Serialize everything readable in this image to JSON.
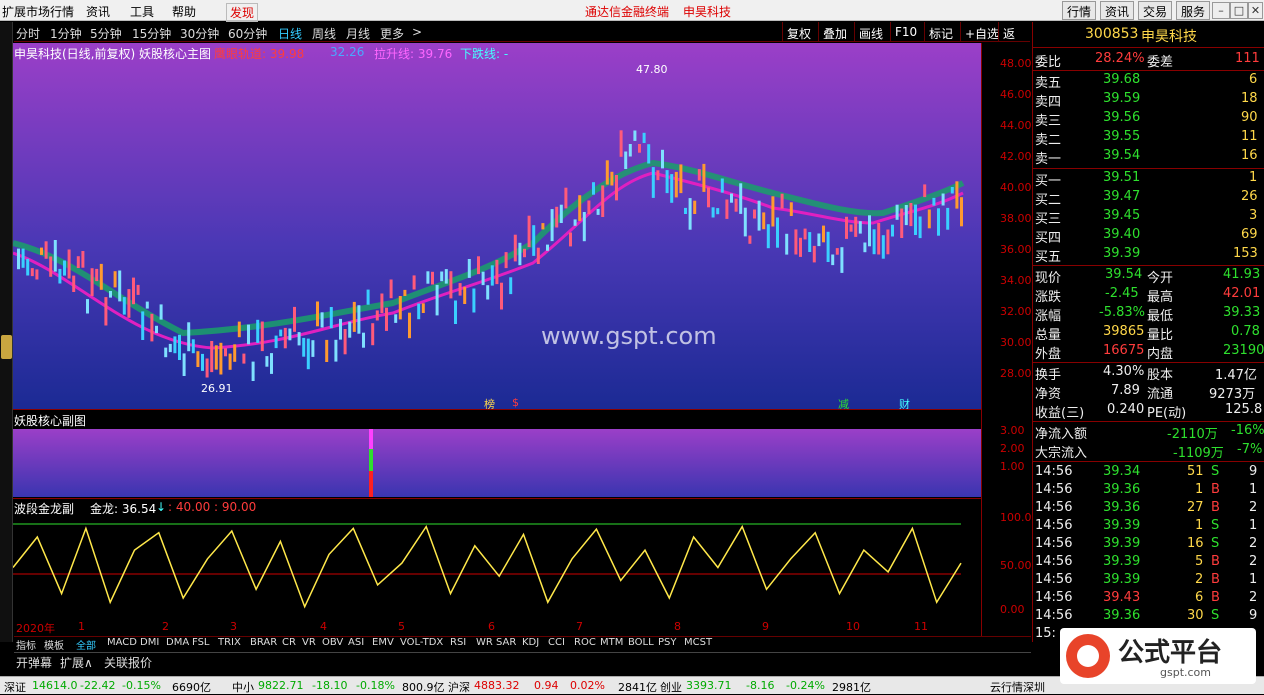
{
  "menubar": {
    "items": [
      "扩展市场行情",
      "资讯",
      "工具",
      "帮助",
      "发现"
    ],
    "center_left": "通达信金融终端",
    "center_right": "申昊科技",
    "right_buttons": [
      "行情",
      "资讯",
      "交易",
      "服务"
    ]
  },
  "periods": {
    "items": [
      "分时",
      "1分钟",
      "5分钟",
      "15分钟",
      "30分钟",
      "60分钟",
      "日线",
      "周线",
      "月线",
      "更多"
    ],
    "more_arrow": ">",
    "tools": [
      "复权",
      "叠加",
      "画线",
      "F10",
      "标记",
      "+自选",
      "返回"
    ]
  },
  "main_chart": {
    "title": "申昊科技(日线,前复权) 妖股核心主图",
    "line1_label": "鹰眼轨道: 39.98",
    "line2_label": "32.26",
    "line3_label": "拉升线: 39.76",
    "line4_label": "下跌线: -",
    "high_label": "47.80",
    "low_label": "26.91",
    "watermark": "www.gspt.com",
    "markers": [
      "榜",
      "$",
      "减",
      "财"
    ],
    "y_ticks": [
      "48.00",
      "46.00",
      "44.00",
      "42.00",
      "40.00",
      "38.00",
      "36.00",
      "34.00",
      "32.00",
      "30.00",
      "28.00"
    ]
  },
  "sub_chart1": {
    "title": "妖股核心副图",
    "y_ticks": [
      "3.00",
      "2.00",
      "1.00"
    ]
  },
  "sub_chart2": {
    "title": "波段金龙副",
    "value_label": "金龙: 36.54",
    "arrow": "↓",
    "levels_label": ": 40.00 : 90.00",
    "y_ticks": [
      "100.0",
      "50.00",
      "0.00"
    ]
  },
  "x_axis": {
    "labels": [
      "2020年",
      "1",
      "2",
      "3",
      "4",
      "5",
      "6",
      "7",
      "8",
      "9",
      "10",
      "11"
    ],
    "period_label": "日线"
  },
  "chart_data": {
    "type": "line",
    "series": [
      {
        "name": "金龙",
        "values": [
          50,
          85,
          20,
          95,
          10,
          70,
          90,
          15,
          60,
          92,
          25,
          80,
          5,
          65,
          95,
          30,
          55,
          97,
          20,
          75,
          40,
          88,
          10,
          60,
          94,
          35,
          70,
          15,
          85,
          50,
          97,
          25,
          60,
          90,
          20,
          70,
          45,
          95,
          10,
          55
        ]
      }
    ],
    "ylim": [
      0,
      100
    ]
  },
  "quote": {
    "code": "300853",
    "name": "申昊科技",
    "weibi_label": "委比",
    "weibi_val": "28.24%",
    "weicha_label": "委差",
    "weicha_val": "111",
    "asks": [
      {
        "label": "卖五",
        "price": "39.68",
        "vol": "6"
      },
      {
        "label": "卖四",
        "price": "39.59",
        "vol": "18"
      },
      {
        "label": "卖三",
        "price": "39.56",
        "vol": "90"
      },
      {
        "label": "卖二",
        "price": "39.55",
        "vol": "11"
      },
      {
        "label": "卖一",
        "price": "39.54",
        "vol": "16"
      }
    ],
    "bids": [
      {
        "label": "买一",
        "price": "39.51",
        "vol": "1"
      },
      {
        "label": "买二",
        "price": "39.47",
        "vol": "26"
      },
      {
        "label": "买三",
        "price": "39.45",
        "vol": "3"
      },
      {
        "label": "买四",
        "price": "39.40",
        "vol": "69"
      },
      {
        "label": "买五",
        "price": "39.39",
        "vol": "153"
      }
    ],
    "stats": [
      {
        "l1": "现价",
        "v1": "39.54",
        "l2": "今开",
        "v2": "41.93",
        "c1": "grn",
        "c2": "grn"
      },
      {
        "l1": "涨跌",
        "v1": "-2.45",
        "l2": "最高",
        "v2": "42.01",
        "c1": "grn",
        "c2": "red"
      },
      {
        "l1": "涨幅",
        "v1": "-5.83%",
        "l2": "最低",
        "v2": "39.33",
        "c1": "grn",
        "c2": "grn"
      },
      {
        "l1": "总量",
        "v1": "39865",
        "l2": "量比",
        "v2": "0.78",
        "c1": "yel",
        "c2": "grn"
      },
      {
        "l1": "外盘",
        "v1": "16675",
        "l2": "内盘",
        "v2": "23190",
        "c1": "red",
        "c2": "grn"
      },
      {
        "l1": "换手",
        "v1": "4.30%",
        "l2": "股本",
        "v2": "1.47亿",
        "c1": "wht",
        "c2": "wht"
      },
      {
        "l1": "净资",
        "v1": "7.89",
        "l2": "流通",
        "v2": "9273万",
        "c1": "wht",
        "c2": "wht"
      },
      {
        "l1": "收益(三)",
        "v1": "0.240",
        "l2": "PE(动)",
        "v2": "125.8",
        "c1": "wht",
        "c2": "wht"
      }
    ],
    "flow": [
      {
        "label": "净流入额",
        "val": "-2110万",
        "pct": "-16%"
      },
      {
        "label": "大宗流入",
        "val": "-1109万",
        "pct": "-7%"
      }
    ],
    "ticks": [
      {
        "t": "14:56",
        "p": "39.34",
        "v": "51",
        "s": "S",
        "n": "9"
      },
      {
        "t": "14:56",
        "p": "39.36",
        "v": "1",
        "s": "B",
        "n": "1"
      },
      {
        "t": "14:56",
        "p": "39.36",
        "v": "27",
        "s": "B",
        "n": "2"
      },
      {
        "t": "14:56",
        "p": "39.39",
        "v": "1",
        "s": "S",
        "n": "1"
      },
      {
        "t": "14:56",
        "p": "39.39",
        "v": "16",
        "s": "S",
        "n": "2"
      },
      {
        "t": "14:56",
        "p": "39.39",
        "v": "5",
        "s": "B",
        "n": "2"
      },
      {
        "t": "14:56",
        "p": "39.39",
        "v": "2",
        "s": "B",
        "n": "1"
      },
      {
        "t": "14:56",
        "p": "39.43",
        "v": "6",
        "s": "B",
        "n": "2"
      },
      {
        "t": "14:56",
        "p": "39.36",
        "v": "30",
        "s": "S",
        "n": "9"
      }
    ],
    "last_time": "15:"
  },
  "indicator_tabs": [
    "指标",
    "模板",
    "全部",
    "MACD",
    "DMI",
    "DMA",
    "FSL",
    "TRIX",
    "BRAR",
    "CR",
    "VR",
    "OBV",
    "ASI",
    "EMV",
    "VOL-TDX",
    "RSI",
    "WR",
    "SAR",
    "KDJ",
    "CCI",
    "ROC",
    "MTM",
    "BOLL",
    "PSY",
    "MCST"
  ],
  "bottom_tabs": [
    "开弹幕",
    "扩展∧",
    "关联报价"
  ],
  "statusbar": {
    "s1": "深证",
    "v1": "14614.0",
    "c1": "-22.42",
    "p1": "-0.15%",
    "a1": "6690亿",
    "s2": "中小",
    "v2": "9822.71",
    "c2": "-18.10",
    "p2": "-0.18%",
    "a2": "800.9亿",
    "s3": "沪深",
    "v3": "4883.32",
    "c3": "0.94",
    "p3": "0.02%",
    "a3": "2841亿",
    "s4": "创业",
    "v4": "3393.71",
    "c4": "-8.16",
    "p4": "-0.24%",
    "a4": "2981亿",
    "tail": "云行情深圳"
  },
  "logo": {
    "text": "公式平台",
    "sub": "gspt.com"
  },
  "colors": {
    "up": "#ff3c3c",
    "down": "#2ee02e",
    "accent": "#3cf",
    "gold": "#ffd84a"
  }
}
